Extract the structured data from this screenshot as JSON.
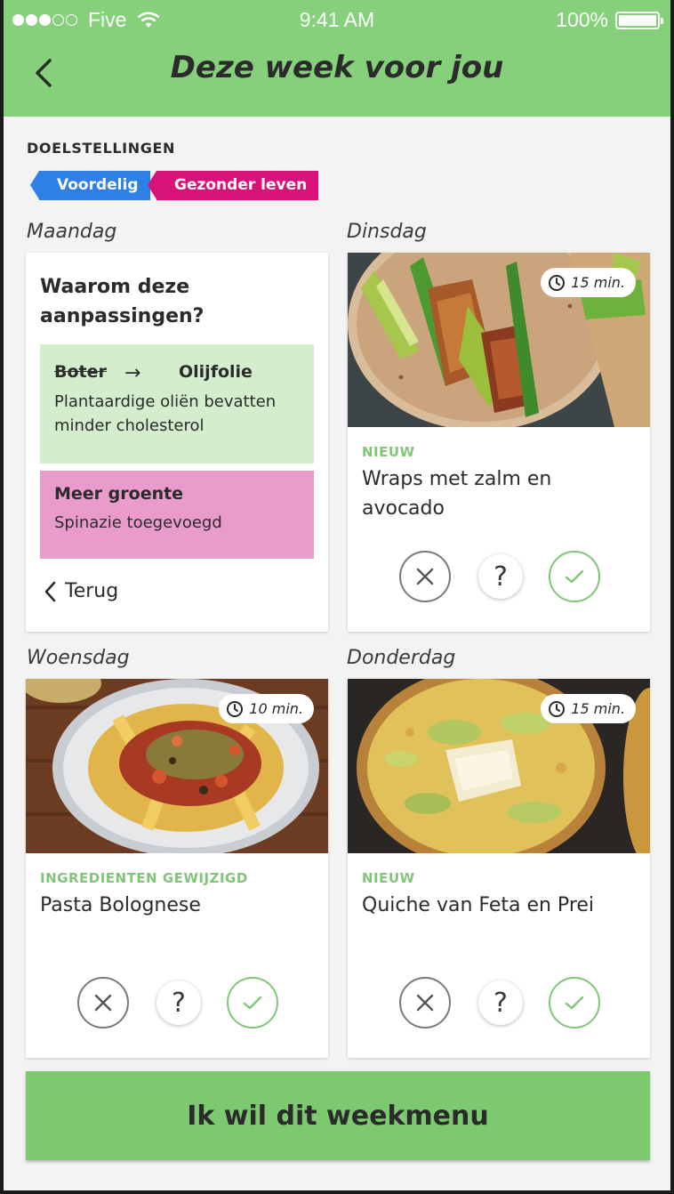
{
  "status_bar": {
    "carrier": "Five",
    "time": "9:41 AM",
    "battery": "100%"
  },
  "header": {
    "title": "Deze week voor jou"
  },
  "goals": {
    "label": "DOELSTELLINGEN",
    "tags": [
      {
        "label": "Voordelig",
        "color": "#2e7fe6"
      },
      {
        "label": "Gezonder leven",
        "color": "#d9127a"
      }
    ]
  },
  "days": {
    "monday": {
      "day_label": "Maandag",
      "card": {
        "title": "Waarom deze aanpassingen?",
        "swap": {
          "from": "Boter",
          "arrow": "→",
          "to": "Olijfolie",
          "description": "Plantaardige oliën bevatten minder cholesterol"
        },
        "extra": {
          "title": "Meer groente",
          "description": "Spinazie toegevoegd"
        },
        "back_label": "Terug"
      }
    },
    "tuesday": {
      "day_label": "Dinsdag",
      "time": "15 min.",
      "badge": "NIEUW",
      "name": "Wraps met zalm en avocado"
    },
    "wednesday": {
      "day_label": "Woensdag",
      "time": "10 min.",
      "badge": "INGREDIENTEN GEWIJZIGD",
      "name": "Pasta Bolognese"
    },
    "thursday": {
      "day_label": "Donderdag",
      "time": "15 min.",
      "badge": "NIEUW",
      "name": "Quiche van Feta en Prei"
    }
  },
  "actions": {
    "help_symbol": "?"
  },
  "cta": {
    "label": "Ik wil dit weekmenu"
  },
  "colors": {
    "header_green": "#86d07c",
    "accent_green": "#7fc777",
    "cta_green": "#7cc96f",
    "swap_box": "#d3edcd",
    "veg_box": "#e99ccb"
  }
}
